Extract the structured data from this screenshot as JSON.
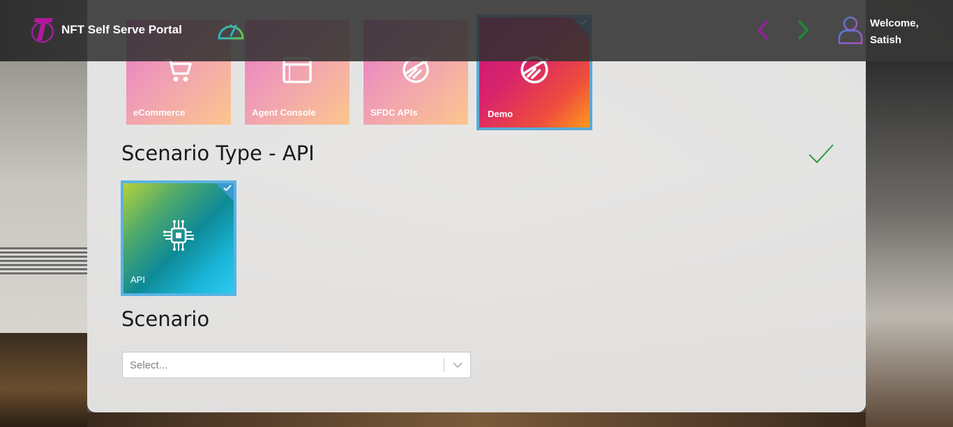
{
  "header": {
    "title": "NFT Self Serve Portal",
    "welcome_line1": "Welcome,",
    "welcome_line2": "Satish",
    "icons": {
      "logo": "telstra-logo-icon",
      "dashboard": "gauge-icon",
      "prev": "chevron-left-icon",
      "next": "chevron-right-icon",
      "user": "user-icon"
    }
  },
  "applications": {
    "tiles": [
      {
        "label": "eCommerce",
        "icon": "cart-icon"
      },
      {
        "label": "Agent Console",
        "icon": "browser-window-icon"
      },
      {
        "label": "SFDC APIs",
        "icon": "api-link-icon"
      },
      {
        "label": "Demo",
        "icon": "api-link-icon",
        "selected": true
      }
    ]
  },
  "scenario_type": {
    "title": "Scenario Type - API",
    "complete": true,
    "tiles": [
      {
        "label": "API",
        "icon": "circuit-chip-icon",
        "selected": true
      }
    ]
  },
  "scenario": {
    "title": "Scenario",
    "select_placeholder": "Select..."
  },
  "colors": {
    "accent_blue": "#3a9bd0",
    "prev_arrow": "#9b1fa0",
    "next_arrow": "#1f8a3a",
    "check_green": "#2e9a3e"
  }
}
